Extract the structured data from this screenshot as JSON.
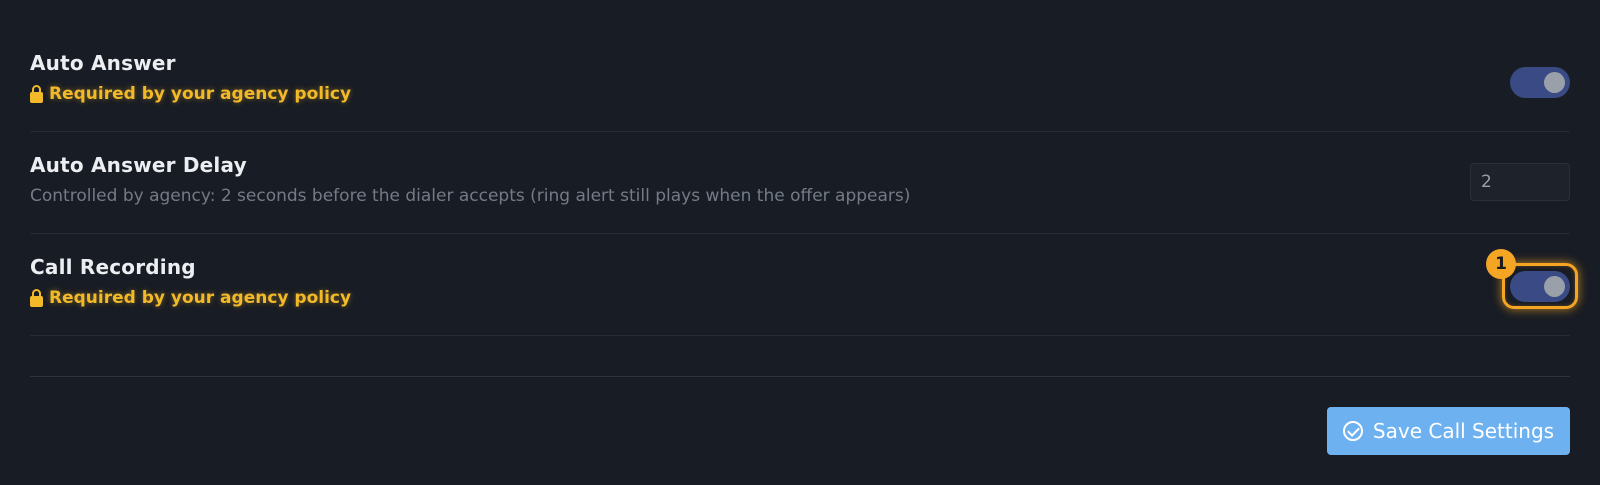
{
  "settings": {
    "auto_answer": {
      "title": "Auto Answer",
      "policy_note": "Required by your agency policy",
      "enabled": true
    },
    "auto_answer_delay": {
      "title": "Auto Answer Delay",
      "description": "Controlled by agency: 2 seconds before the dialer accepts (ring alert still plays when the offer appears)",
      "value": "2"
    },
    "call_recording": {
      "title": "Call Recording",
      "policy_note": "Required by your agency policy",
      "enabled": true
    }
  },
  "annotation": {
    "badge_number": "1"
  },
  "actions": {
    "save_label": "Save Call Settings"
  },
  "colors": {
    "background": "#181c24",
    "policy_warning": "#f2b928",
    "toggle_on": "#3a4a84",
    "highlight": "#f5a524",
    "primary_button": "#6eb1f0"
  },
  "icons": {
    "policy": "lock-icon",
    "save": "check-circle-icon"
  }
}
